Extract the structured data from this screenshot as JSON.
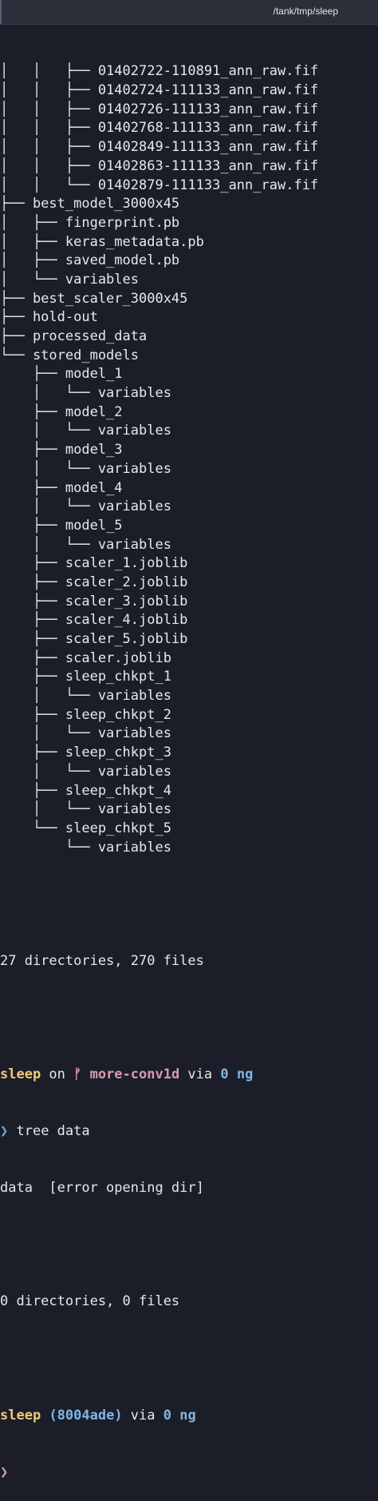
{
  "window": {
    "title": "/tank/tmp/sleep"
  },
  "tree_lines": [
    "│   │   ├── 01402722-110891_ann_raw.fif",
    "│   │   ├── 01402724-111133_ann_raw.fif",
    "│   │   ├── 01402726-111133_ann_raw.fif",
    "│   │   ├── 01402768-111133_ann_raw.fif",
    "│   │   ├── 01402849-111133_ann_raw.fif",
    "│   │   ├── 01402863-111133_ann_raw.fif",
    "│   │   └── 01402879-111133_ann_raw.fif",
    "├── best_model_3000x45",
    "│   ├── fingerprint.pb",
    "│   ├── keras_metadata.pb",
    "│   ├── saved_model.pb",
    "│   └── variables",
    "├── best_scaler_3000x45",
    "├── hold-out",
    "├── processed_data",
    "└── stored_models",
    "    ├── model_1",
    "    │   └── variables",
    "    ├── model_2",
    "    │   └── variables",
    "    ├── model_3",
    "    │   └── variables",
    "    ├── model_4",
    "    │   └── variables",
    "    ├── model_5",
    "    │   └── variables",
    "    ├── scaler_1.joblib",
    "    ├── scaler_2.joblib",
    "    ├── scaler_3.joblib",
    "    ├── scaler_4.joblib",
    "    ├── scaler_5.joblib",
    "    ├── scaler.joblib",
    "    ├── sleep_chkpt_1",
    "    │   └── variables",
    "    ├── sleep_chkpt_2",
    "    │   └── variables",
    "    ├── sleep_chkpt_3",
    "    │   └── variables",
    "    ├── sleep_chkpt_4",
    "    │   └── variables",
    "    └── sleep_chkpt_5",
    "        └── variables"
  ],
  "summary1": "27 directories, 270 files",
  "prompt1": {
    "dir": "sleep",
    "on": " on ",
    "branch_icon": "ᚠ",
    "branch": "more-conv1d",
    "via": " via ",
    "lang_icon": "0",
    "lang": "ng"
  },
  "cmd1": {
    "chevron": "❯",
    "text": " tree data"
  },
  "output1": "data  [error opening dir]",
  "summary2": "0 directories, 0 files",
  "prompt2": {
    "dir": "sleep",
    "commit": "(8004ade)",
    "via": " via ",
    "lang_icon": "0",
    "lang": "ng"
  },
  "cmd2": {
    "chevron": "❯"
  }
}
